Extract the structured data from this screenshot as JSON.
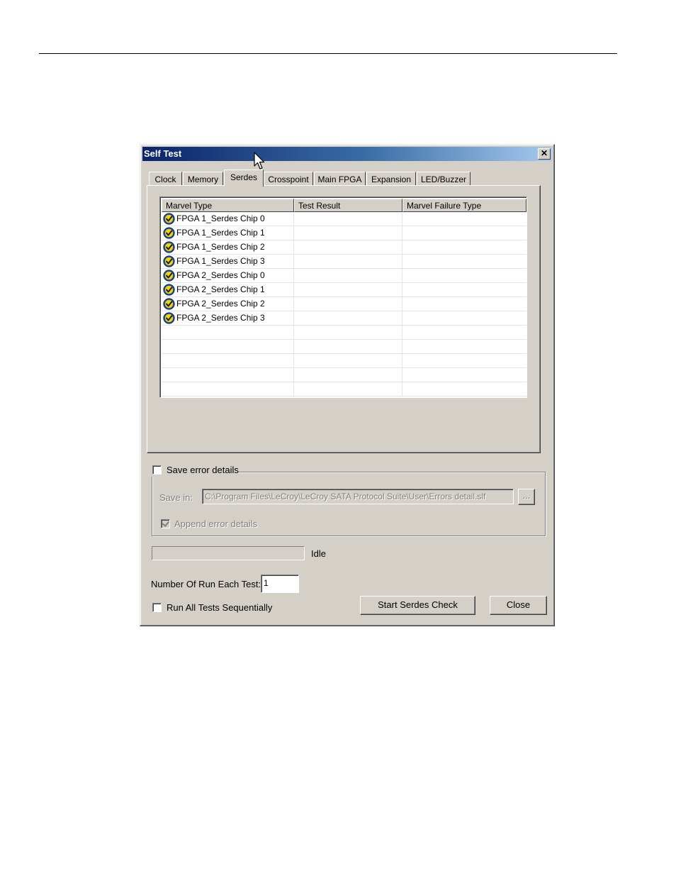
{
  "window": {
    "title": "Self Test",
    "close_glyph": "✕"
  },
  "tabs": [
    {
      "label": "Clock"
    },
    {
      "label": "Memory"
    },
    {
      "label": "Serdes"
    },
    {
      "label": "Crosspoint"
    },
    {
      "label": "Main FPGA"
    },
    {
      "label": "Expansion"
    },
    {
      "label": "LED/Buzzer"
    }
  ],
  "active_tab": "Serdes",
  "table": {
    "columns": [
      "Marvel Type",
      "Test Result",
      "Marvel Failure Type"
    ],
    "rows": [
      {
        "name": "FPGA 1_Serdes Chip 0",
        "icon": "check-badge-icon",
        "result": "",
        "failure": ""
      },
      {
        "name": "FPGA 1_Serdes Chip 1",
        "icon": "check-badge-icon",
        "result": "",
        "failure": ""
      },
      {
        "name": "FPGA 1_Serdes Chip 2",
        "icon": "check-badge-icon",
        "result": "",
        "failure": ""
      },
      {
        "name": "FPGA 1_Serdes Chip 3",
        "icon": "check-badge-icon",
        "result": "",
        "failure": ""
      },
      {
        "name": "FPGA 2_Serdes Chip 0",
        "icon": "check-badge-icon",
        "result": "",
        "failure": ""
      },
      {
        "name": "FPGA 2_Serdes Chip 1",
        "icon": "check-badge-icon",
        "result": "",
        "failure": ""
      },
      {
        "name": "FPGA 2_Serdes Chip 2",
        "icon": "check-badge-icon",
        "result": "",
        "failure": ""
      },
      {
        "name": "FPGA 2_Serdes Chip 3",
        "icon": "check-badge-icon",
        "result": "",
        "failure": ""
      }
    ],
    "empty_rows": 5
  },
  "save_error": {
    "checkbox_label": "Save error details",
    "checked": false,
    "save_in_label": "Save in:",
    "save_in_value": "C:\\Program Files\\LeCroy\\LeCroy SATA Protocol Suite\\User\\Errors detail.slf",
    "browse_label": "...",
    "append_label": "Append error details",
    "append_checked": true
  },
  "status": {
    "progress": 0,
    "text": "Idle"
  },
  "runs": {
    "label": "Number Of Run Each Test:",
    "value": "1"
  },
  "sequential": {
    "label": "Run All Tests Sequentially",
    "checked": false
  },
  "buttons": {
    "start": "Start Serdes Check",
    "close": "Close"
  },
  "colors": {
    "titlebar_start": "#0a246a",
    "titlebar_end": "#a6caf0",
    "face": "#d4d0c8",
    "icon_blue": "#1f4fae",
    "icon_yellow": "#f2d500"
  }
}
